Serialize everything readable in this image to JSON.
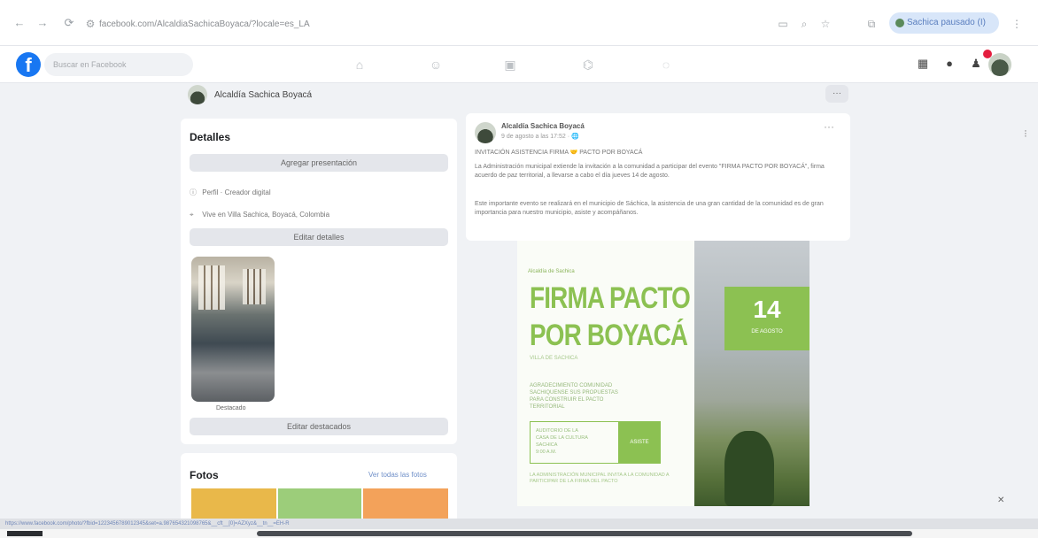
{
  "browser": {
    "nav": {
      "back": "←",
      "forward": "→",
      "reload": "⟳"
    },
    "url": "facebook.com/AlcaldiaSachicaBoyaca/?locale=es_LA",
    "icons": [
      "reader-icon",
      "zoom-icon",
      "bookmark-star-icon",
      "extensions-icon"
    ],
    "profile_label": "Sachica pausado (I)"
  },
  "fb": {
    "logo": "f",
    "search_placeholder": "Buscar en Facebook",
    "right_icons": [
      "apps-grid-icon",
      "messenger-icon",
      "notifications-icon"
    ]
  },
  "page": {
    "name": "Alcaldía Sachica Boyacá",
    "more_label": "···"
  },
  "details": {
    "title": "Detalles",
    "add_presentation": "Agregar presentación",
    "rows": [
      {
        "icon": "ⓘ",
        "text": "Perfil · Creador digital"
      },
      {
        "icon": "⌖",
        "text": "Vive en Villa Sachica, Boyacá, Colombia"
      }
    ],
    "edit_details": "Editar detalles",
    "featured_label": "Destacado",
    "edit_featured": "Editar destacados"
  },
  "photos": {
    "title": "Fotos",
    "see_all": "Ver todas las fotos"
  },
  "post": {
    "author": "Alcaldía Sachica Boyacá",
    "meta": "9 de agosto a las 17:52 · 🌐",
    "more": "···",
    "line1": "INVITACIÓN ASISTENCIA FIRMA 🤝 PACTO POR BOYACÁ",
    "para1": "La Administración municipal extiende la invitación a la comunidad a participar del evento \"FIRMA PACTO POR BOYACÁ\", firma acuerdo de paz territorial, a llevarse a cabo el día jueves 14 de agosto.",
    "para2": "Este importante evento se realizará en el municipio de Sáchica, la asistencia de una gran cantidad de la comunidad es de gran importancia para nuestro municipio, asiste y acompáñanos."
  },
  "poster": {
    "small_top": "Alcaldía de Sachica",
    "title1": "FIRMA PACTO",
    "title2": "POR BOYACÁ",
    "subtitle": "VILLA DE SACHICA",
    "date_num": "14",
    "date_month": "DE AGOSTO",
    "lines": [
      "AGRADECIMIENTO COMUNIDAD",
      "SACHIQUENSE SUS PROPUESTAS",
      "PARA CONSTRUIR EL PACTO",
      "TERRITORIAL"
    ],
    "box_lines": [
      "AUDITORIO DE LA",
      "CASA DE LA CULTURA",
      "SACHICA",
      "9:00 A.M."
    ],
    "box_button": "ASISTE",
    "footer": "LA ADMINISTRACIÓN MUNICIPAL INVITA A LA COMUNIDAD A PARTICIPAR DE LA FIRMA DEL PACTO"
  },
  "status_url": "https://www.facebook.com/photo/?fbid=1223456789012345&set=a.987654321098765&__cft__[0]=AZXyz&__tn__=EH-R",
  "colors": {
    "fb_blue": "#1877f2",
    "poster_green": "#8cc152",
    "page_bg": "#f0f2f5"
  }
}
